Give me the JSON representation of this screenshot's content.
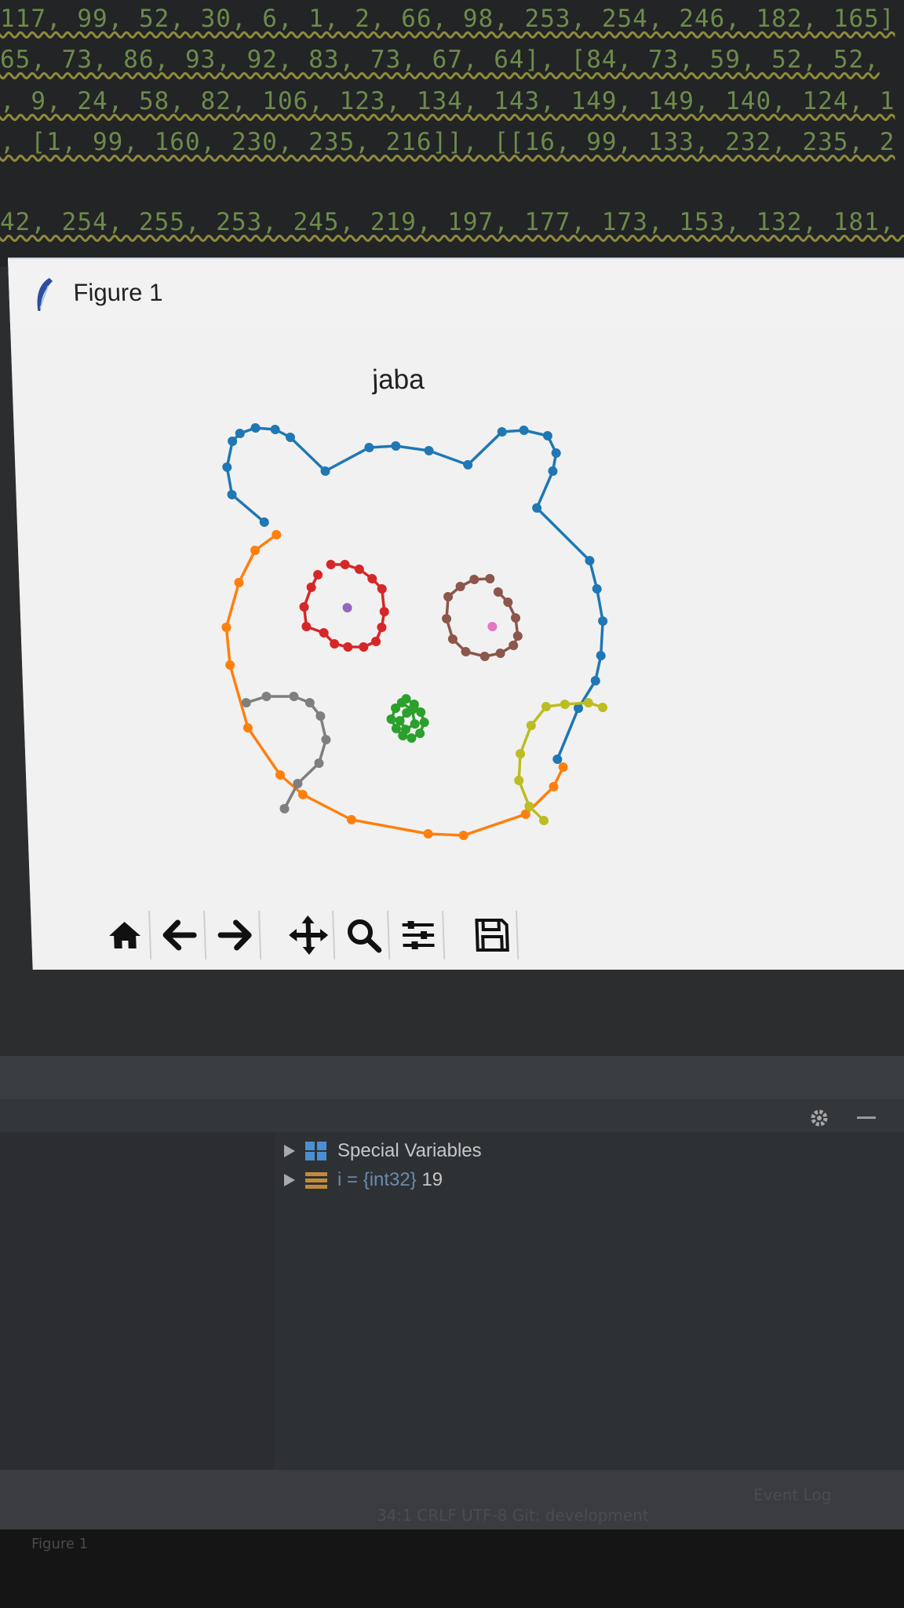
{
  "editor": {
    "lines": [
      "117, 99, 52, 30, 6, 1, 2, 66, 98, 253, 254, 246, 182, 165]",
      "65, 73, 86, 93, 92, 83, 73, 67, 64], [84, 73, 59, 52, 52,",
      ", 9, 24, 58, 82, 106, 123, 134, 143, 149, 149, 140, 124, 1",
      ", [1, 99, 160, 230, 235, 216]], [[16, 99, 133, 232, 235, 2",
      "42, 254, 255, 253, 245, 219, 197, 177, 173, 153, 132, 181, ["
    ]
  },
  "window": {
    "title": "Figure 1",
    "icon": "feather-icon"
  },
  "toolbar": {
    "buttons": [
      "home-icon",
      "back-arrow-icon",
      "forward-arrow-icon",
      "pan-icon",
      "zoom-icon",
      "configure-subplots-icon",
      "save-icon"
    ]
  },
  "chart_data": {
    "type": "line",
    "title": "jaba",
    "axes": "off",
    "grid": false,
    "series": [
      {
        "color": "#1f77b4",
        "points": [
          [
            325,
            663
          ],
          [
            285,
            628
          ],
          [
            280,
            593
          ],
          [
            288,
            560
          ],
          [
            298,
            550
          ],
          [
            318,
            543
          ],
          [
            343,
            545
          ],
          [
            362,
            555
          ],
          [
            405,
            598
          ],
          [
            462,
            568
          ],
          [
            496,
            566
          ],
          [
            538,
            572
          ],
          [
            587,
            590
          ],
          [
            632,
            548
          ],
          [
            660,
            546
          ],
          [
            690,
            553
          ],
          [
            700,
            575
          ],
          [
            695,
            598
          ],
          [
            673,
            645
          ],
          [
            738,
            712
          ],
          [
            746,
            748
          ],
          [
            752,
            789
          ],
          [
            748,
            833
          ],
          [
            740,
            865
          ],
          [
            717,
            900
          ],
          [
            688,
            965
          ]
        ]
      },
      {
        "color": "#ff7f0e",
        "points": [
          [
            340,
            679
          ],
          [
            312,
            699
          ],
          [
            290,
            740
          ],
          [
            272,
            797
          ],
          [
            275,
            845
          ],
          [
            295,
            925
          ],
          [
            334,
            985
          ],
          [
            362,
            1010
          ],
          [
            423,
            1042
          ],
          [
            520,
            1060
          ],
          [
            565,
            1062
          ],
          [
            645,
            1035
          ],
          [
            682,
            1000
          ],
          [
            695,
            975
          ]
        ]
      },
      {
        "color": "#d62728",
        "points": [
          [
            408,
            717
          ],
          [
            426,
            717
          ],
          [
            444,
            723
          ],
          [
            460,
            735
          ],
          [
            472,
            748
          ],
          [
            474,
            777
          ],
          [
            470,
            797
          ],
          [
            462,
            815
          ],
          [
            446,
            822
          ],
          [
            426,
            822
          ],
          [
            409,
            818
          ],
          [
            396,
            804
          ],
          [
            374,
            796
          ],
          [
            372,
            771
          ],
          [
            382,
            746
          ],
          [
            391,
            730
          ]
        ]
      },
      {
        "color": "#9467bd",
        "points": [
          [
            427,
            772
          ]
        ]
      },
      {
        "color": "#8c564b",
        "points": [
          [
            610,
            735
          ],
          [
            590,
            736
          ],
          [
            572,
            745
          ],
          [
            556,
            758
          ],
          [
            553,
            786
          ],
          [
            560,
            812
          ],
          [
            576,
            828
          ],
          [
            600,
            834
          ],
          [
            620,
            830
          ],
          [
            637,
            820
          ],
          [
            643,
            808
          ],
          [
            641,
            785
          ],
          [
            632,
            765
          ],
          [
            620,
            752
          ]
        ]
      },
      {
        "color": "#e377c2",
        "points": [
          [
            611,
            796
          ]
        ]
      },
      {
        "color": "#7f7f7f",
        "points": [
          [
            294,
            893
          ],
          [
            320,
            885
          ],
          [
            355,
            885
          ],
          [
            375,
            893
          ],
          [
            388,
            910
          ],
          [
            394,
            940
          ],
          [
            384,
            970
          ],
          [
            356,
            996
          ],
          [
            338,
            1028
          ]
        ]
      },
      {
        "color": "#2ca02c",
        "points": [
          [
            498,
            888
          ],
          [
            508,
            895
          ],
          [
            516,
            905
          ],
          [
            520,
            918
          ],
          [
            514,
            932
          ],
          [
            503,
            938
          ],
          [
            492,
            935
          ],
          [
            484,
            926
          ],
          [
            478,
            914
          ],
          [
            484,
            900
          ],
          [
            492,
            893
          ],
          [
            505,
            902
          ],
          [
            508,
            920
          ],
          [
            496,
            927
          ],
          [
            489,
            916
          ],
          [
            498,
            906
          ]
        ]
      },
      {
        "color": "#bcbd22",
        "points": [
          [
            748,
            899
          ],
          [
            730,
            893
          ],
          [
            700,
            895
          ],
          [
            676,
            898
          ],
          [
            656,
            922
          ],
          [
            641,
            958
          ],
          [
            638,
            992
          ],
          [
            650,
            1025
          ],
          [
            668,
            1043
          ]
        ]
      }
    ]
  },
  "variables": {
    "section_label": "Special Variables",
    "item_name": "i",
    "item_type": " = {int32} ",
    "item_value": "19"
  },
  "statusbar": {
    "text": "Event Log",
    "info": "34:1   CRLF   UTF-8   Git: development"
  },
  "taskbar": {
    "item": "Figure 1"
  }
}
